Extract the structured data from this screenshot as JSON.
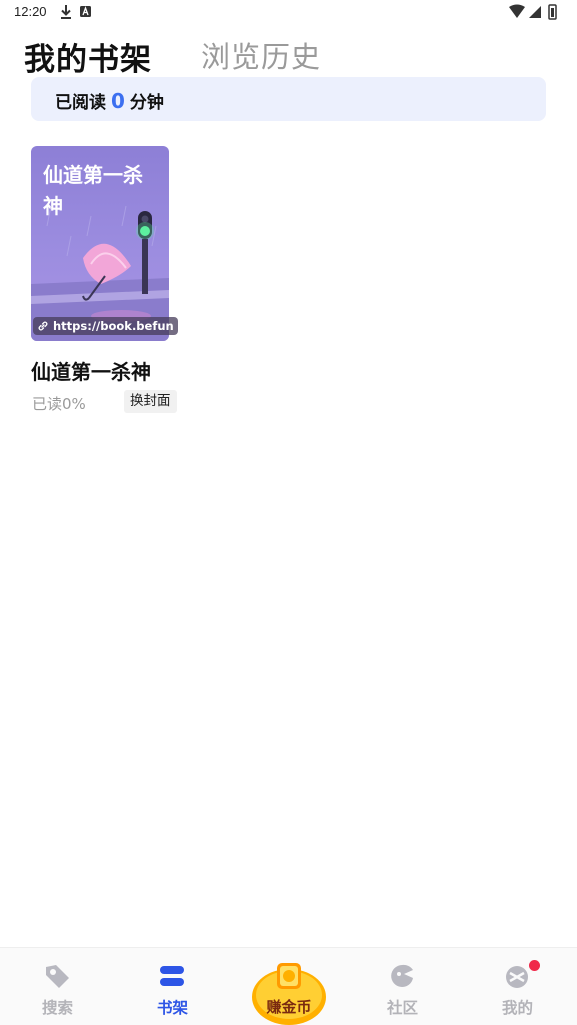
{
  "status_bar": {
    "time": "12:20"
  },
  "tabs": {
    "bookshelf": "我的书架",
    "history": "浏览历史"
  },
  "reading": {
    "prefix": "已阅读",
    "minutes": "0",
    "suffix": "分钟"
  },
  "book": {
    "cover_title": "仙道第一杀神",
    "cover_url": "https://book.befun",
    "name": "仙道第一杀神",
    "progress": "已读0%",
    "change_cover_label": "换封面"
  },
  "bottom_nav": {
    "items": [
      {
        "label": "搜索",
        "icon": "tag-icon",
        "active": false
      },
      {
        "label": "书架",
        "icon": "bookshelf-icon",
        "active": true
      },
      {
        "label": "赚金币",
        "icon": "coin-badge-icon",
        "active": false
      },
      {
        "label": "社区",
        "icon": "community-icon",
        "active": false
      },
      {
        "label": "我的",
        "icon": "profile-icon",
        "active": false
      }
    ]
  },
  "colors": {
    "accent": "#2d55e6",
    "banner_bg": "#ecf0fd",
    "minutes": "#3c6ff0",
    "badge_dot": "#f0294a"
  }
}
